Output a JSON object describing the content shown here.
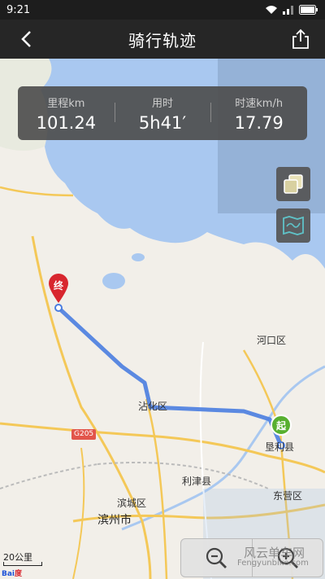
{
  "status": {
    "time": "9:21"
  },
  "header": {
    "title": "骑行轨迹"
  },
  "stats": [
    {
      "label": "里程km",
      "value": "101.24"
    },
    {
      "label": "用时",
      "value": "5h41′"
    },
    {
      "label": "时速km/h",
      "value": "17.79"
    }
  ],
  "map": {
    "labels": {
      "hekou": "河口区",
      "zhanhua": "沾化区",
      "kenli": "垦利县",
      "lijin": "利津县",
      "dongying": "东营区",
      "bincheng": "滨城区",
      "binzhou": "滨州市",
      "g205": "G205"
    },
    "markers": {
      "start": "起",
      "end": "终"
    },
    "scale": "20公里",
    "attribution": "Bai度地图"
  },
  "watermark": {
    "text": "风云单车网",
    "url": "Fengyunbike.com"
  },
  "colors": {
    "route": "#4a7de0",
    "start": "#58b030",
    "end": "#d8262e",
    "water": "#a9c8f0"
  }
}
